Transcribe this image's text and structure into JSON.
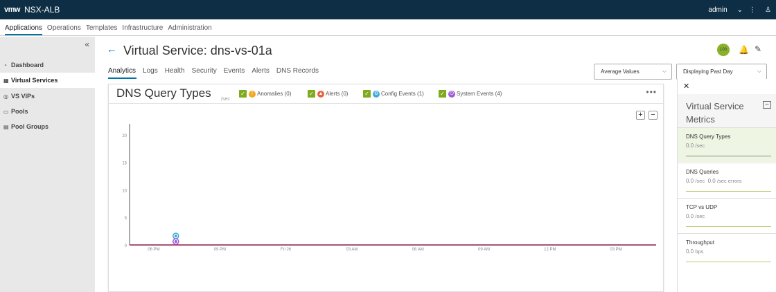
{
  "header": {
    "logo": "vmw",
    "app_name": "NSX-ALB",
    "user": "admin",
    "chevron": "⌄",
    "kebab": "⋮",
    "user_icon": "♙"
  },
  "nav": {
    "tabs": [
      "Applications",
      "Operations",
      "Templates",
      "Infrastructure",
      "Administration"
    ],
    "active": 0
  },
  "sidebar": {
    "collapse": "«",
    "items": [
      {
        "label": "Dashboard",
        "icon": "◔"
      },
      {
        "label": "Virtual Services",
        "icon": "▦"
      },
      {
        "label": "VS VIPs",
        "icon": "◎"
      },
      {
        "label": "Pools",
        "icon": "▭"
      },
      {
        "label": "Pool Groups",
        "icon": "▤"
      }
    ],
    "active": 1
  },
  "page": {
    "back": "←",
    "title": "Virtual Service:  dns-vs-01a",
    "health_score": "100",
    "bell": "🔔",
    "edit": "✎",
    "tabs": [
      "Analytics",
      "Logs",
      "Health",
      "Security",
      "Events",
      "Alerts",
      "DNS Records"
    ],
    "active_tab": 0,
    "value_select": "Average Values",
    "time_select": "Displaying Past Day",
    "caret": "⌵"
  },
  "chart": {
    "title": "DNS Query Types",
    "unit": "/sec",
    "more": "•••",
    "zoom_in": "+",
    "zoom_out": "−",
    "legend": [
      {
        "label": "Anomalies (0)",
        "color": "#f5a623",
        "icon": "!"
      },
      {
        "label": "Alerts (0)",
        "color": "#e8633c",
        "icon": "▲"
      },
      {
        "label": "Config Events (1)",
        "color": "#3fa9d6",
        "icon": "⚙"
      },
      {
        "label": "System Events (4)",
        "color": "#a35bd8",
        "icon": "⏻"
      }
    ],
    "check": "✓"
  },
  "chart_data": {
    "type": "line",
    "x_ticks": [
      "06 PM",
      "09 PM",
      "Fri 26",
      "03 AM",
      "06 AM",
      "09 AM",
      "12 PM",
      "03 PM"
    ],
    "y_ticks": [
      0,
      5,
      10,
      15,
      20
    ],
    "ylim": [
      0,
      22
    ],
    "series": [
      {
        "values": [
          0,
          0,
          0,
          0,
          0,
          0,
          0,
          0
        ]
      }
    ],
    "line_color": "#8b1a4a",
    "event_markers": [
      {
        "type": "Config Events",
        "x_hours_from_first_tick": 1.0,
        "color": "#3fa9d6"
      },
      {
        "type": "System Events",
        "x_hours_from_first_tick": 1.0,
        "color": "#a35bd8"
      }
    ]
  },
  "metrics": {
    "close": "✕",
    "title": "Virtual Service Metrics",
    "collapse": "−",
    "cards": [
      {
        "name": "DNS Query Types",
        "value": "0.0",
        "unit": "/sec",
        "extra_value": "",
        "extra_unit": ""
      },
      {
        "name": "DNS Queries",
        "value": "0.0",
        "unit": "/sec",
        "extra_value": "0.0",
        "extra_unit": "/sec errors"
      },
      {
        "name": "TCP vs UDP",
        "value": "0.0",
        "unit": "/sec",
        "extra_value": "",
        "extra_unit": ""
      },
      {
        "name": "Throughput",
        "value": "0.0",
        "unit": "bps",
        "extra_value": "",
        "extra_unit": ""
      }
    ],
    "selected": 0
  }
}
